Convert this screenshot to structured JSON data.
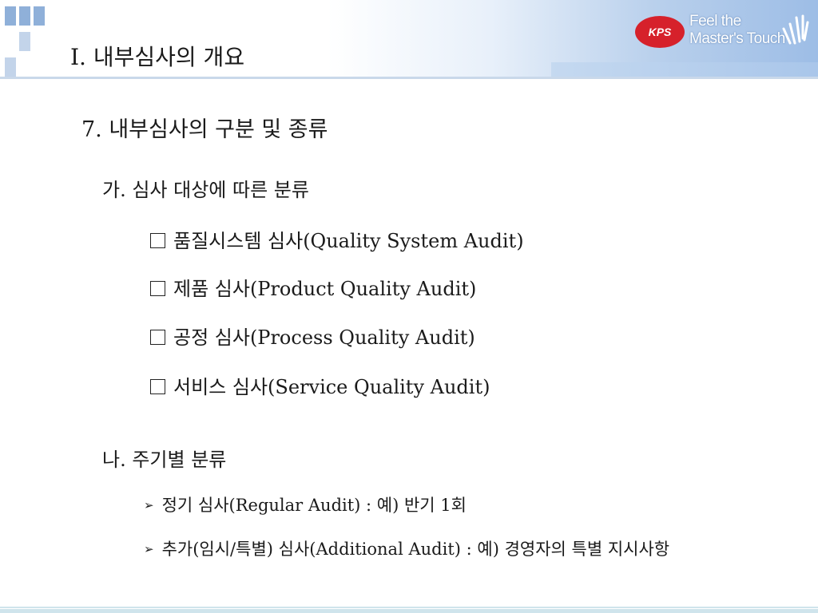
{
  "header": {
    "title": "Ⅰ. 내부심사의 개요",
    "logo_mark": "KPS",
    "logo_line1": "Feel the",
    "logo_line2": "Master's Touch",
    "accent_color": "#9dbde6",
    "logo_color": "#d6212b"
  },
  "main": {
    "heading": "7. 내부심사의 구분 및 종류",
    "section_a": {
      "title": "가. 심사 대상에 따른 분류",
      "items": [
        "품질시스템 심사(Quality System Audit)",
        "제품 심사(Product Quality Audit)",
        "공정 심사(Process Quality Audit)",
        "서비스  심사(Service Quality Audit)"
      ]
    },
    "section_b": {
      "title": "나. 주기별 분류",
      "items": [
        "정기 심사(Regular Audit) : 예) 반기 1회",
        "추가(임시/특별) 심사(Additional Audit) : 예) 경영자의 특별 지시사항"
      ]
    }
  }
}
